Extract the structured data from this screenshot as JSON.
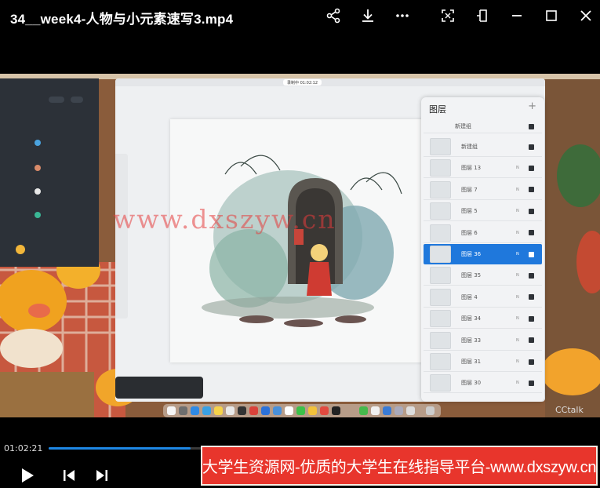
{
  "window": {
    "title": "34__week4-人物与小元素速写3.mp4"
  },
  "toolbar_icons": [
    "share-icon",
    "download-icon",
    "more-icon",
    "screenshot-icon",
    "pin-icon",
    "minimize-icon",
    "maximize-icon",
    "close-icon"
  ],
  "video": {
    "app_tab_label": "录制中 01:02:12",
    "watermark_text": "www.dxszyw.cn",
    "brand_text": "CCtalk",
    "layers_panel": {
      "title": "图层",
      "add_icon": "+",
      "items": [
        {
          "name": "新建组",
          "mode": "",
          "active": false
        },
        {
          "name": "新建组",
          "mode": "",
          "active": false
        },
        {
          "name": "图层 13",
          "mode": "N",
          "active": false
        },
        {
          "name": "图层 7",
          "mode": "N",
          "active": false
        },
        {
          "name": "图层 5",
          "mode": "N",
          "active": false
        },
        {
          "name": "图层 6",
          "mode": "N",
          "active": false
        },
        {
          "name": "图层 36",
          "mode": "N",
          "active": true
        },
        {
          "name": "图层 35",
          "mode": "N",
          "active": false
        },
        {
          "name": "图层 4",
          "mode": "N",
          "active": false
        },
        {
          "name": "图层 34",
          "mode": "N",
          "active": false
        },
        {
          "name": "图层 33",
          "mode": "N",
          "active": false
        },
        {
          "name": "图层 31",
          "mode": "N",
          "active": false
        },
        {
          "name": "图层 30",
          "mode": "N",
          "active": false
        }
      ]
    }
  },
  "playback": {
    "current_time": "01:02:21",
    "progress_percent": 26
  },
  "banner": {
    "text": "大学生资源网-优质的大学生在线指导平台-www.dxszyw.cn"
  },
  "colors": {
    "accent": "#1e88e5",
    "banner_bg": "#e8352c",
    "active_layer": "#1f78dc"
  }
}
